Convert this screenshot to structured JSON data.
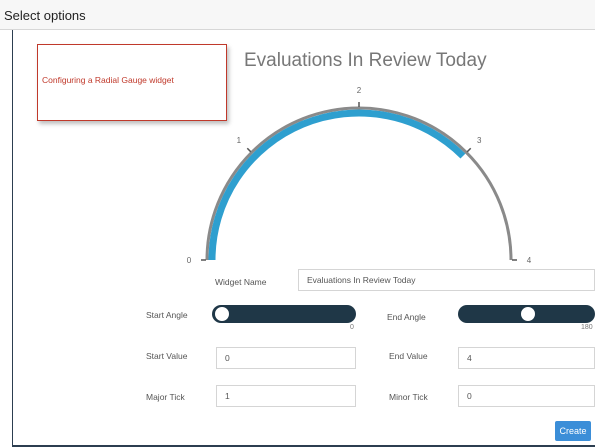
{
  "window": {
    "title": "Select options"
  },
  "callout": {
    "text": "Configuring a Radial Gauge widget"
  },
  "gauge": {
    "title": "Evaluations In Review Today",
    "min": 0,
    "max": 4,
    "value": 3,
    "tick_labels": [
      "0",
      "1",
      "2",
      "3",
      "4"
    ],
    "colors": {
      "track": "#8a8a8a",
      "fill": "#2e9fcf"
    }
  },
  "form": {
    "widget_name_label": "Widget Name",
    "widget_name_value": "Evaluations In Review Today",
    "start_angle_label": "Start Angle",
    "start_angle_value": "0",
    "end_angle_label": "End Angle",
    "end_angle_value": "180",
    "start_value_label": "Start Value",
    "start_value_value": "0",
    "end_value_label": "End Value",
    "end_value_value": "4",
    "major_tick_label": "Major Tick",
    "major_tick_value": "1",
    "minor_tick_label": "Minor Tick",
    "minor_tick_value": "0",
    "start_angle_fraction": 0,
    "end_angle_fraction": 0.5
  },
  "buttons": {
    "create_label": "Create"
  },
  "colors": {
    "slider": "#1f3747",
    "accent": "#3b8ed8",
    "callout": "#c0392b"
  }
}
